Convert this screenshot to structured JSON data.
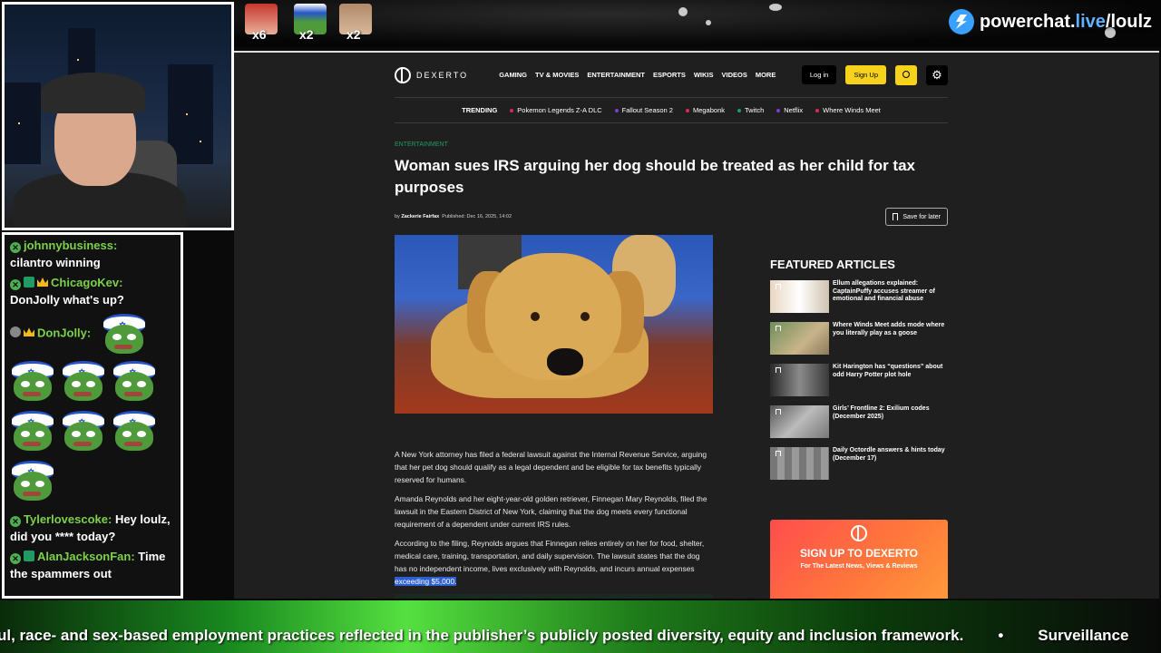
{
  "overlay": {
    "brand_prefix": "powerchat.",
    "brand_live": "live",
    "brand_suffix": "/loulz",
    "badges": [
      {
        "count": "x6"
      },
      {
        "count": "x2"
      },
      {
        "count": "x2"
      }
    ]
  },
  "chat": {
    "messages": [
      {
        "user": "johnnybusiness:",
        "text": "cilantro winning"
      },
      {
        "user": "ChicagoKev:",
        "text": "DonJolly what's up?"
      },
      {
        "user": "DonJolly:",
        "text": ""
      },
      {
        "user": "Tylerlovescoke:",
        "text": "Hey loulz, did you **** today?"
      },
      {
        "user": "AlanJacksonFan:",
        "text": "Time the spammers out"
      }
    ]
  },
  "site": {
    "logo_text": "DEXERTO",
    "nav": [
      "GAMING",
      "TV & MOVIES",
      "ENTERTAINMENT",
      "ESPORTS",
      "WIKIS",
      "VIDEOS",
      "MORE"
    ],
    "login": "Log in",
    "signup": "Sign Up",
    "trending_label": "TRENDING",
    "trending": [
      {
        "label": "Pokemon Legends Z-A DLC",
        "color": "#d03050"
      },
      {
        "label": "Fallout Season 2",
        "color": "#7a3fd0"
      },
      {
        "label": "Megabonk",
        "color": "#d03050"
      },
      {
        "label": "Twitch",
        "color": "#1e9c64"
      },
      {
        "label": "Netflix",
        "color": "#7a3fd0"
      },
      {
        "label": "Where Winds Meet",
        "color": "#d03050"
      }
    ]
  },
  "article": {
    "category": "ENTERTAINMENT",
    "title": "Woman sues IRS arguing her dog should be treated as her child for tax purposes",
    "byline_prefix": "by",
    "author": "Zackerie Fairfax",
    "published": "Published: Dec 16, 2025, 14:02",
    "save_label": "Save for later",
    "p1": "A New York attorney has filed a federal lawsuit against the Internal Revenue Service, arguing that her pet dog should qualify as a legal dependent and be eligible for tax benefits typically reserved for humans.",
    "p2": "Amanda Reynolds and her eight-year-old golden retriever, Finnegan Mary Reynolds, filed the lawsuit in the Eastern District of New York, claiming that the dog meets every functional requirement of a dependent under current IRS rules.",
    "p3": "According to the filing, Reynolds argues that Finnegan relies entirely on her for food, shelter, medical care, training, transportation, and daily supervision. The lawsuit states that the dog has no independent income, lives exclusively with Reynolds, and incurs annual expenses",
    "p3_highlight": "exceeding $5,000."
  },
  "featured": {
    "title": "FEATURED ARTICLES",
    "items": [
      {
        "title": "Ellum allegations explained: CaptainPuffy accuses streamer of emotional and financial abuse"
      },
      {
        "title": "Where Winds Meet adds mode where you literally play as a goose"
      },
      {
        "title": "Kit Harington has “questions” about odd Harry Potter plot hole"
      },
      {
        "title": "Girls’ Frontline 2: Exilium codes (December 2025)"
      },
      {
        "title": "Daily Octordle answers & hints today (December 17)"
      }
    ]
  },
  "signup_card": {
    "title": "SIGN UP TO DEXERTO",
    "subtitle": "For The Latest News, Views & Reviews"
  },
  "ticker": {
    "text": "ul, race- and sex-based employment practices reflected in the publisher’s publicly posted diversity, equity and inclusion framework.",
    "next": "Surveillance"
  }
}
